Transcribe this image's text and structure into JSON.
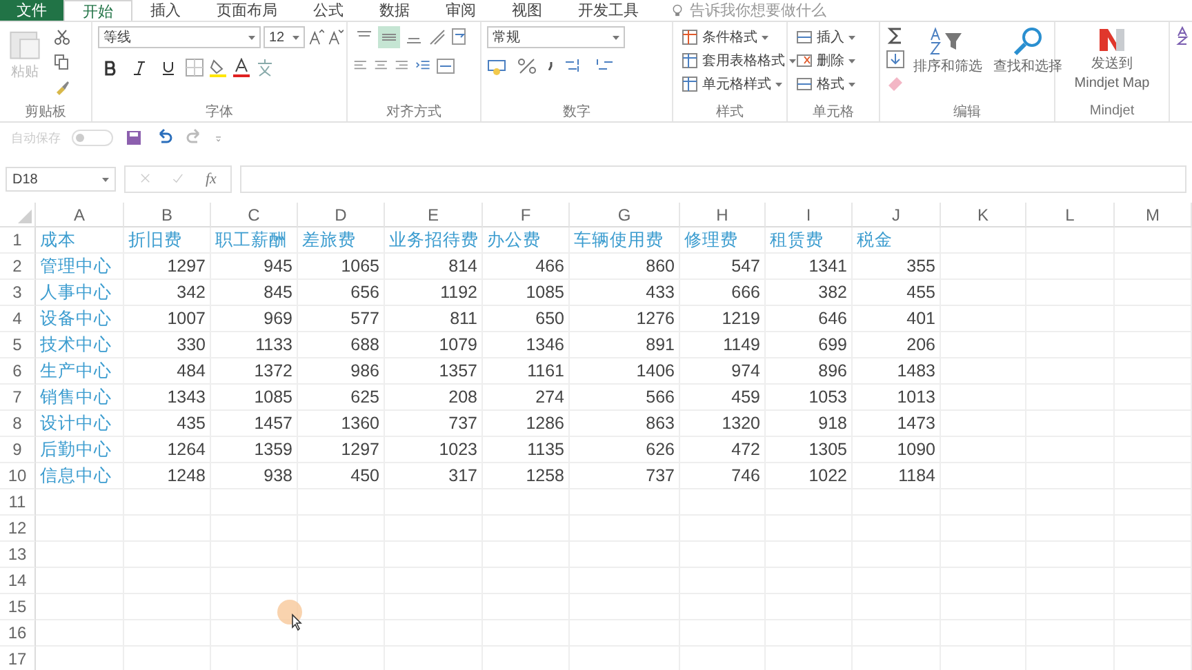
{
  "tabs": [
    {
      "label": "文件",
      "kind": "file",
      "selected": false
    },
    {
      "label": "开始",
      "kind": "tab",
      "selected": true
    },
    {
      "label": "插入",
      "kind": "tab",
      "selected": false
    },
    {
      "label": "页面布局",
      "kind": "tab",
      "selected": false
    },
    {
      "label": "公式",
      "kind": "tab",
      "selected": false
    },
    {
      "label": "数据",
      "kind": "tab",
      "selected": false
    },
    {
      "label": "审阅",
      "kind": "tab",
      "selected": false
    },
    {
      "label": "视图",
      "kind": "tab",
      "selected": false
    },
    {
      "label": "开发工具",
      "kind": "tab",
      "selected": false
    }
  ],
  "tell_me": {
    "placeholder": "告诉我你想要做什么"
  },
  "ribbon": {
    "clipboard": {
      "label": "剪贴板",
      "paste": "粘贴"
    },
    "font": {
      "label": "字体",
      "font_name": "等线",
      "font_size": "12"
    },
    "alignment": {
      "label": "对齐方式",
      "vertical_align": [
        {
          "selected": false
        },
        {
          "selected": true
        },
        {
          "selected": false
        }
      ]
    },
    "number": {
      "label": "数字",
      "format": "常规"
    },
    "styles": {
      "label": "样式",
      "items": [
        "条件格式",
        "套用表格格式",
        "单元格样式"
      ]
    },
    "cells": {
      "label": "单元格",
      "items": [
        "插入",
        "删除",
        "格式"
      ]
    },
    "editing": {
      "label": "编辑",
      "sort": "排序和筛选",
      "find": "查找和选择"
    },
    "mindjet": {
      "label": "Mindjet",
      "button_lines": [
        "发送到",
        "Mindjet Map"
      ]
    }
  },
  "quick_access": {
    "autosave": {
      "label": "自动保存",
      "on": false
    }
  },
  "formula_bar": {
    "name_box": "D18",
    "fx": "fx"
  },
  "sheet": {
    "columns": [
      "A",
      "B",
      "C",
      "D",
      "E",
      "F",
      "G",
      "H",
      "I",
      "J",
      "K",
      "L",
      "M"
    ],
    "rows": [
      {
        "number": "1",
        "cells": [
          "成本",
          "折旧费",
          "职工薪酬",
          "差旅费",
          "业务招待费",
          "办公费",
          "车辆使用费",
          "修理费",
          "租赁费",
          "税金"
        ]
      },
      {
        "number": "2",
        "cells": [
          "管理中心",
          "1297",
          "945",
          "1065",
          "814",
          "466",
          "860",
          "547",
          "1341",
          "355"
        ]
      },
      {
        "number": "3",
        "cells": [
          "人事中心",
          "342",
          "845",
          "656",
          "1192",
          "1085",
          "433",
          "666",
          "382",
          "455"
        ]
      },
      {
        "number": "4",
        "cells": [
          "设备中心",
          "1007",
          "969",
          "577",
          "811",
          "650",
          "1276",
          "1219",
          "646",
          "401"
        ]
      },
      {
        "number": "5",
        "cells": [
          "技术中心",
          "330",
          "1133",
          "688",
          "1079",
          "1346",
          "891",
          "1149",
          "699",
          "206"
        ]
      },
      {
        "number": "6",
        "cells": [
          "生产中心",
          "484",
          "1372",
          "986",
          "1357",
          "1161",
          "1406",
          "974",
          "896",
          "1483"
        ]
      },
      {
        "number": "7",
        "cells": [
          "销售中心",
          "1343",
          "1085",
          "625",
          "208",
          "274",
          "566",
          "459",
          "1053",
          "1013"
        ]
      },
      {
        "number": "8",
        "cells": [
          "设计中心",
          "435",
          "1457",
          "1360",
          "737",
          "1286",
          "863",
          "1320",
          "918",
          "1473"
        ]
      },
      {
        "number": "9",
        "cells": [
          "后勤中心",
          "1264",
          "1359",
          "1297",
          "1023",
          "1135",
          "626",
          "472",
          "1305",
          "1090"
        ]
      },
      {
        "number": "10",
        "cells": [
          "信息中心",
          "1248",
          "938",
          "450",
          "317",
          "1258",
          "737",
          "746",
          "1022",
          "1184"
        ]
      },
      {
        "number": "11"
      },
      {
        "number": "12"
      },
      {
        "number": "13"
      },
      {
        "number": "14"
      },
      {
        "number": "15"
      },
      {
        "number": "16"
      },
      {
        "number": "17"
      }
    ]
  }
}
